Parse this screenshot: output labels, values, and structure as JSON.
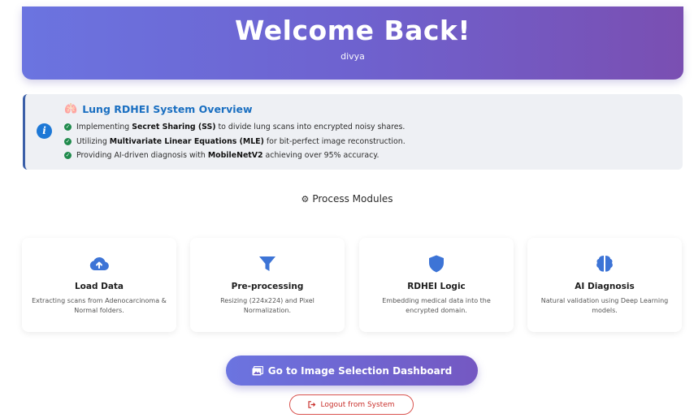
{
  "header": {
    "title": "Welcome Back!",
    "username": "divya"
  },
  "overview": {
    "title": "Lung RDHEI System Overview",
    "items": [
      {
        "before": "Implementing ",
        "bold": "Secret Sharing (SS)",
        "after": " to divide lung scans into encrypted noisy shares."
      },
      {
        "before": "Utilizing ",
        "bold": "Multivariate Linear Equations (MLE)",
        "after": " for bit-perfect image reconstruction."
      },
      {
        "before": "Providing AI-driven diagnosis with ",
        "bold": "MobileNetV2",
        "after": " achieving over 95% accuracy."
      }
    ]
  },
  "modules": {
    "heading": "Process Modules",
    "cards": [
      {
        "title": "Load Data",
        "description": "Extracting scans from Adenocarcinoma & Normal folders.",
        "icon": "cloud-upload-icon"
      },
      {
        "title": "Pre-processing",
        "description": "Resizing (224x224) and Pixel Normalization.",
        "icon": "filter-icon"
      },
      {
        "title": "RDHEI Logic",
        "description": "Embedding medical data into the encrypted domain.",
        "icon": "shield-icon"
      },
      {
        "title": "AI Diagnosis",
        "description": "Natural validation using Deep Learning models.",
        "icon": "brain-icon"
      }
    ]
  },
  "actions": {
    "primary_label": "Go to Image Selection Dashboard",
    "logout_label": "Logout from System"
  },
  "colors": {
    "accent": "#6b74e0",
    "accent_dark": "#7a4fb2",
    "link_blue": "#1a6fc1",
    "check_green": "#1f8a4c",
    "icon_blue": "#3d74d6",
    "danger": "#c9302c"
  }
}
